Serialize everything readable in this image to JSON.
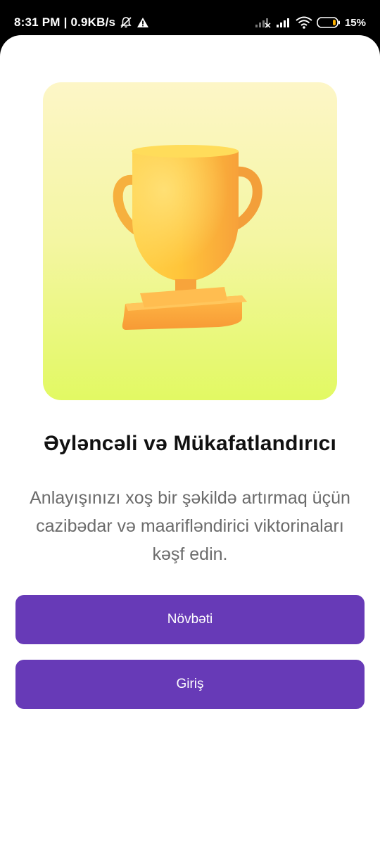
{
  "status_bar": {
    "time_and_speed": "8:31 PM | 0.9KB/s",
    "battery_percent": "15%",
    "icons": [
      "muted-bell-icon",
      "warning-icon",
      "signal-off-icon",
      "signal-icon",
      "wifi-icon",
      "battery-icon"
    ]
  },
  "onboarding": {
    "illustration": "trophy-icon",
    "title": "Əyləncəli və Mükafatlandırıcı",
    "description": "Anlayışınızı xoş bir şəkildə artırmaq üçün cazibədar və maarifləndirici viktorinaları kəşf edin.",
    "next_button_label": "Növbəti",
    "login_button_label": "Giriş"
  },
  "colors": {
    "primary_button": "#673ab7",
    "card_gradient_top": "#fdf6c7",
    "card_gradient_bottom": "#e2f963",
    "trophy": "#ffb43a"
  }
}
